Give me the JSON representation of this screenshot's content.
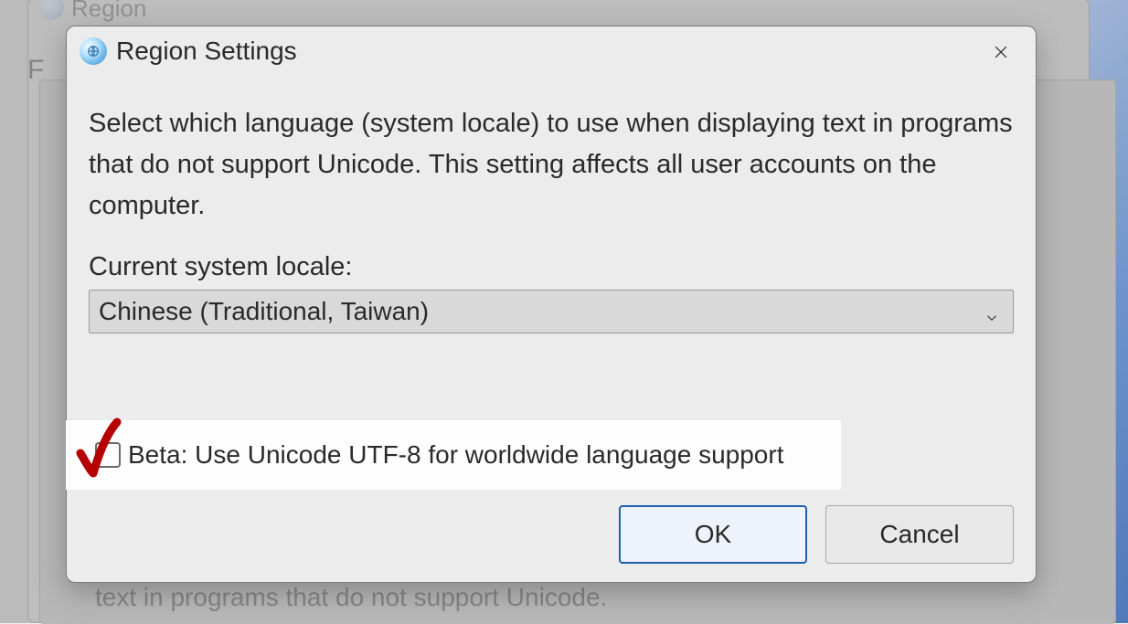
{
  "back": {
    "title": "Region",
    "tab": "F",
    "body_line": "text in programs that do not support Unicode."
  },
  "dialog": {
    "title": "Region Settings",
    "description": "Select which language (system locale) to use when displaying text in programs that do not support Unicode. This setting affects all user accounts on the computer.",
    "locale_label": "Current system locale:",
    "locale_value": "Chinese (Traditional, Taiwan)",
    "utf8_label": "Beta: Use Unicode UTF-8 for worldwide language support",
    "ok": "OK",
    "cancel": "Cancel"
  }
}
